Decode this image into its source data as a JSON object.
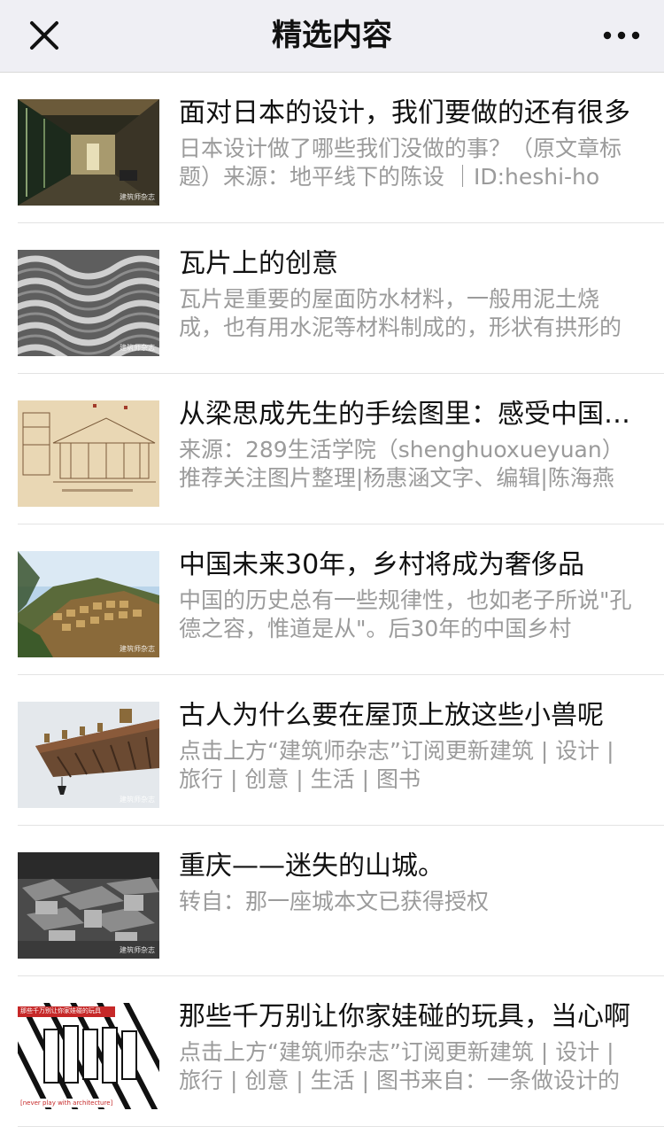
{
  "header": {
    "title": "精选内容"
  },
  "articles": [
    {
      "title": "面对日本的设计，我们要做的还有很多",
      "desc": "日本设计做了哪些我们没做的事？（原文章标题）来源：地平线下的陈设 ｜ID:heshi-ho"
    },
    {
      "title": "瓦片上的创意",
      "desc": "瓦片是重要的屋面防水材料，一般用泥土烧成，也有用水泥等材料制成的，形状有拱形的"
    },
    {
      "title": "从梁思成先生的手绘图里：感受中国古建",
      "desc": "来源：289生活学院（shenghuoxueyuan）推荐关注图片整理|杨惠涵文字、编辑|陈海燕"
    },
    {
      "title": "中国未来30年，乡村将成为奢侈品",
      "desc": "中国的历史总有一些规律性，也如老子所说\"孔德之容，惟道是从\"。后30年的中国乡村"
    },
    {
      "title": "古人为什么要在屋顶上放这些小兽呢",
      "desc": "点击上方“建筑师杂志”订阅更新建筑 | 设计 | 旅行 | 创意 | 生活 | 图书"
    },
    {
      "title": "重庆——迷失的山城。",
      "desc": "转自：那一座城本文已获得授权"
    },
    {
      "title": "那些千万别让你家娃碰的玩具，当心啊",
      "desc": "点击上方“建筑师杂志”订阅更新建筑 | 设计 | 旅行 | 创意 | 生活 | 图书来自：一条做设计的"
    }
  ],
  "thumbs": {
    "watermark": "建筑师杂志",
    "toy_banner": "那些千万别让你家娃碰的玩具",
    "toy_caption": "[never play with architecture]"
  },
  "icons": {
    "close": "close-icon",
    "more": "more-dots-icon"
  }
}
